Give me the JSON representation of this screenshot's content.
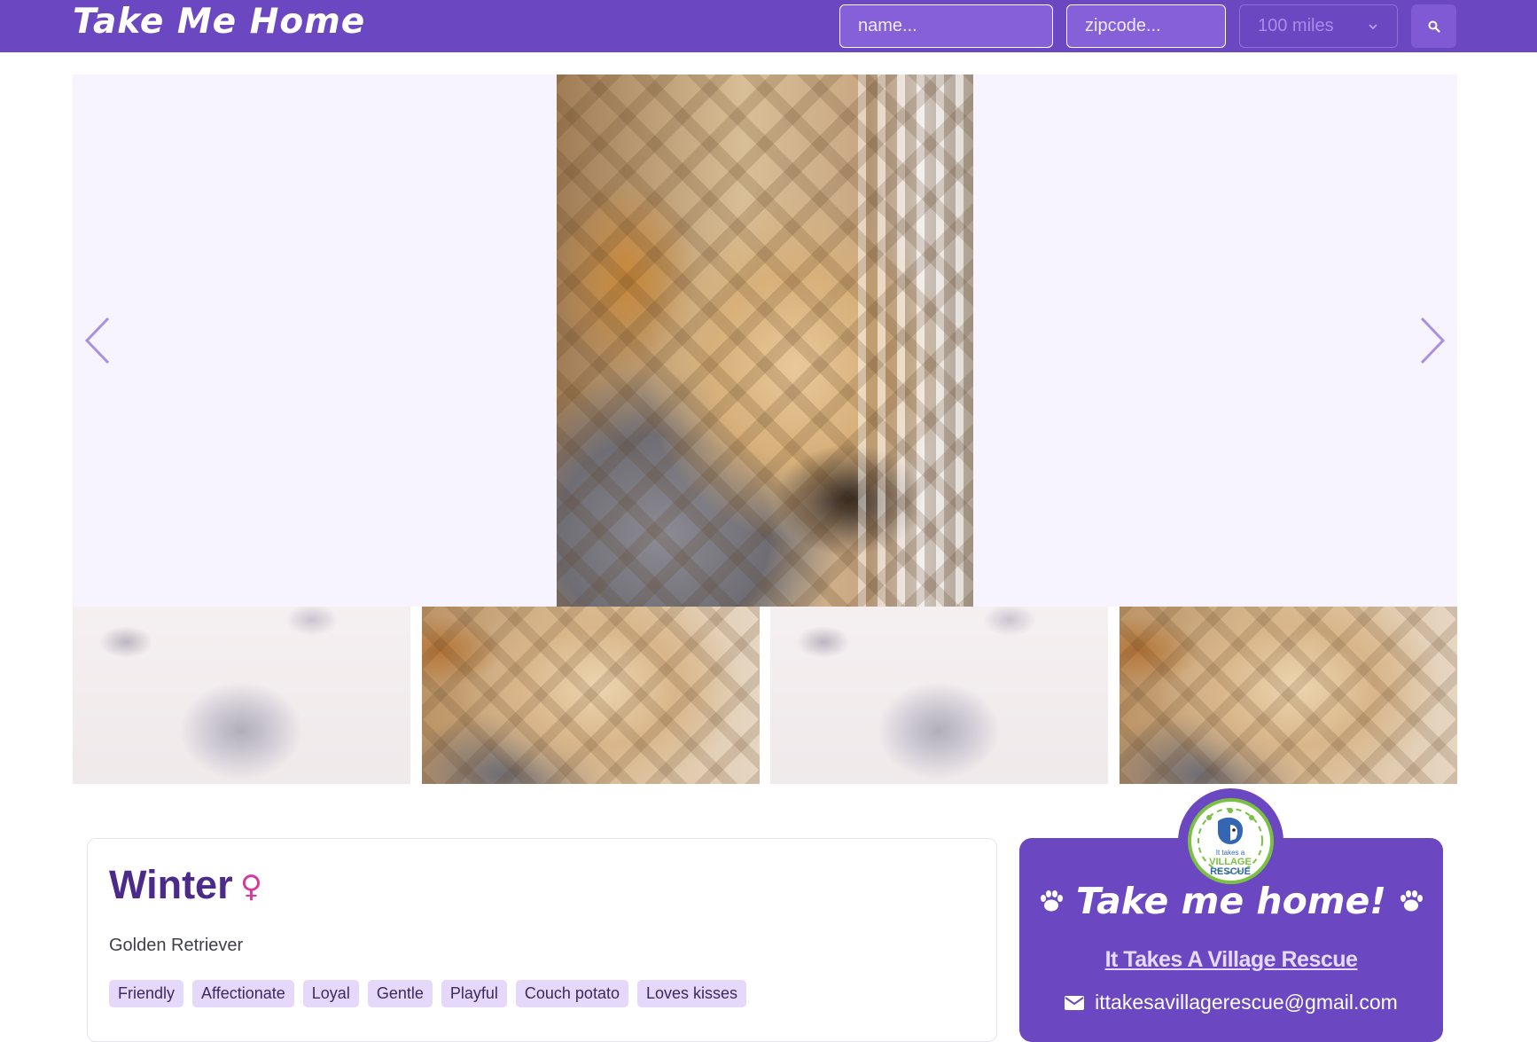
{
  "header": {
    "brand": "Take Me Home",
    "name_placeholder": "name...",
    "zip_placeholder": "zipcode...",
    "distance": "100 miles",
    "accent": "#6b47c1"
  },
  "gallery": {
    "prev_icon": "chevron-left-icon",
    "next_icon": "chevron-right-icon",
    "thumbnail_count": 4
  },
  "pet": {
    "name": "Winter",
    "gender_symbol": "♀",
    "breed": "Golden Retriever",
    "tags": [
      "Friendly",
      "Affectionate",
      "Loyal",
      "Gentle",
      "Playful",
      "Couch potato",
      "Loves kisses"
    ]
  },
  "rescue": {
    "title": "Take me home!",
    "name": "It Takes A Village Rescue",
    "email": "ittakesavillagerescue@gmail.com",
    "logo_text_1": "It takes a",
    "logo_text_2": "VILLAGE",
    "logo_text_3": "RESCUE"
  }
}
